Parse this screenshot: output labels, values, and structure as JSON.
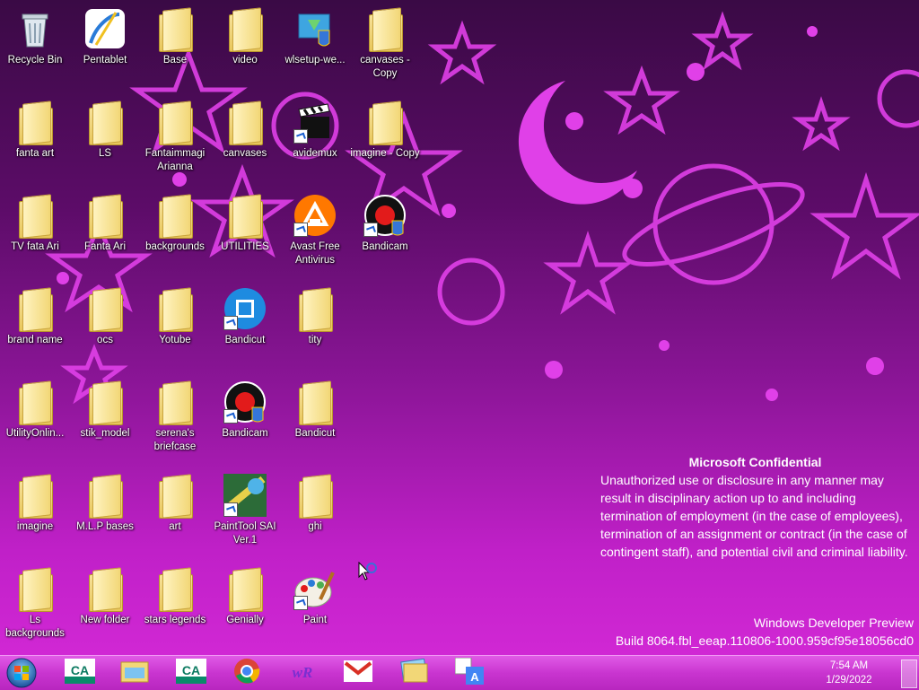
{
  "desktop": {
    "icons": [
      {
        "label": "Recycle Bin",
        "kind": "recycle",
        "shortcut": false
      },
      {
        "label": "Pentablet",
        "kind": "pentablet",
        "shortcut": false
      },
      {
        "label": "Base",
        "kind": "folder",
        "shortcut": false
      },
      {
        "label": "video",
        "kind": "folder",
        "shortcut": false
      },
      {
        "label": "wlsetup-we...",
        "kind": "installer",
        "shortcut": false
      },
      {
        "label": "canvases - Copy",
        "kind": "folder",
        "shortcut": false
      },
      {
        "label": "fanta art",
        "kind": "folder",
        "shortcut": false
      },
      {
        "label": "LS",
        "kind": "folder",
        "shortcut": false
      },
      {
        "label": "Fantaimmagi Arianna",
        "kind": "folder",
        "shortcut": false
      },
      {
        "label": "canvases",
        "kind": "folder",
        "shortcut": false
      },
      {
        "label": "avidemux",
        "kind": "clapper",
        "shortcut": true
      },
      {
        "label": "imagine - Copy",
        "kind": "folder",
        "shortcut": false
      },
      {
        "label": "TV  fata Ari",
        "kind": "folder",
        "shortcut": false
      },
      {
        "label": "Fanta Ari",
        "kind": "folder",
        "shortcut": false
      },
      {
        "label": "backgrounds",
        "kind": "folder",
        "shortcut": false
      },
      {
        "label": "UTILITIES",
        "kind": "folder",
        "shortcut": false
      },
      {
        "label": "Avast Free Antivirus",
        "kind": "avast",
        "shortcut": true
      },
      {
        "label": "Bandicam",
        "kind": "bandicam",
        "shortcut": true
      },
      {
        "label": "brand name",
        "kind": "folder",
        "shortcut": false
      },
      {
        "label": "ocs",
        "kind": "folder",
        "shortcut": false
      },
      {
        "label": "Yotube",
        "kind": "folder",
        "shortcut": false
      },
      {
        "label": "Bandicut",
        "kind": "bandicut",
        "shortcut": true
      },
      {
        "label": "tity",
        "kind": "folder",
        "shortcut": false
      },
      {
        "label": "UtilityOnlin...",
        "kind": "folder",
        "shortcut": false
      },
      {
        "label": "stik_model",
        "kind": "folder",
        "shortcut": false
      },
      {
        "label": "serena's briefcase",
        "kind": "folder",
        "shortcut": false
      },
      {
        "label": "Bandicam",
        "kind": "bandicam",
        "shortcut": true
      },
      {
        "label": "Bandicut",
        "kind": "folder",
        "shortcut": false
      },
      {
        "label": "imagine",
        "kind": "folder",
        "shortcut": false
      },
      {
        "label": "M.L.P bases",
        "kind": "folder",
        "shortcut": false
      },
      {
        "label": "art",
        "kind": "folder",
        "shortcut": false
      },
      {
        "label": "PaintTool SAI Ver.1",
        "kind": "sai",
        "shortcut": true
      },
      {
        "label": "ghi",
        "kind": "folder",
        "shortcut": false
      },
      {
        "label": "Ls backgrounds",
        "kind": "folder",
        "shortcut": false
      },
      {
        "label": "New folder",
        "kind": "folder",
        "shortcut": false
      },
      {
        "label": "stars legends",
        "kind": "folder",
        "shortcut": false
      },
      {
        "label": "Genially",
        "kind": "folder",
        "shortcut": false
      },
      {
        "label": "Paint",
        "kind": "paint",
        "shortcut": true
      }
    ]
  },
  "confidential": {
    "title": "Microsoft Confidential",
    "body": "Unauthorized use or disclosure in any manner may result in disciplinary action up to and including termination of employment (in the case of employees), termination of an assignment or contract (in the case of contingent staff), and potential civil and criminal liability."
  },
  "watermark": {
    "line1": "Windows Developer Preview",
    "line2": "Build 8064.fbl_eeap.110806-1000.959cf95e18056cd0"
  },
  "taskbar": {
    "pinned": [
      {
        "name": "credit-agricole-icon",
        "text": "CA"
      },
      {
        "name": "file-explorer-icon",
        "text": ""
      },
      {
        "name": "credit-agricole-icon-2",
        "text": "CA"
      },
      {
        "name": "chrome-icon",
        "text": ""
      },
      {
        "name": "wordreference-icon",
        "text": "wR"
      },
      {
        "name": "gmail-icon",
        "text": "M"
      },
      {
        "name": "photos-icon",
        "text": ""
      },
      {
        "name": "translate-icon",
        "text": "A"
      }
    ],
    "time": "7:54 AM",
    "date": "1/29/2022"
  },
  "colors": {
    "taskbar": "#c935d0",
    "accent": "#d62ad8"
  }
}
